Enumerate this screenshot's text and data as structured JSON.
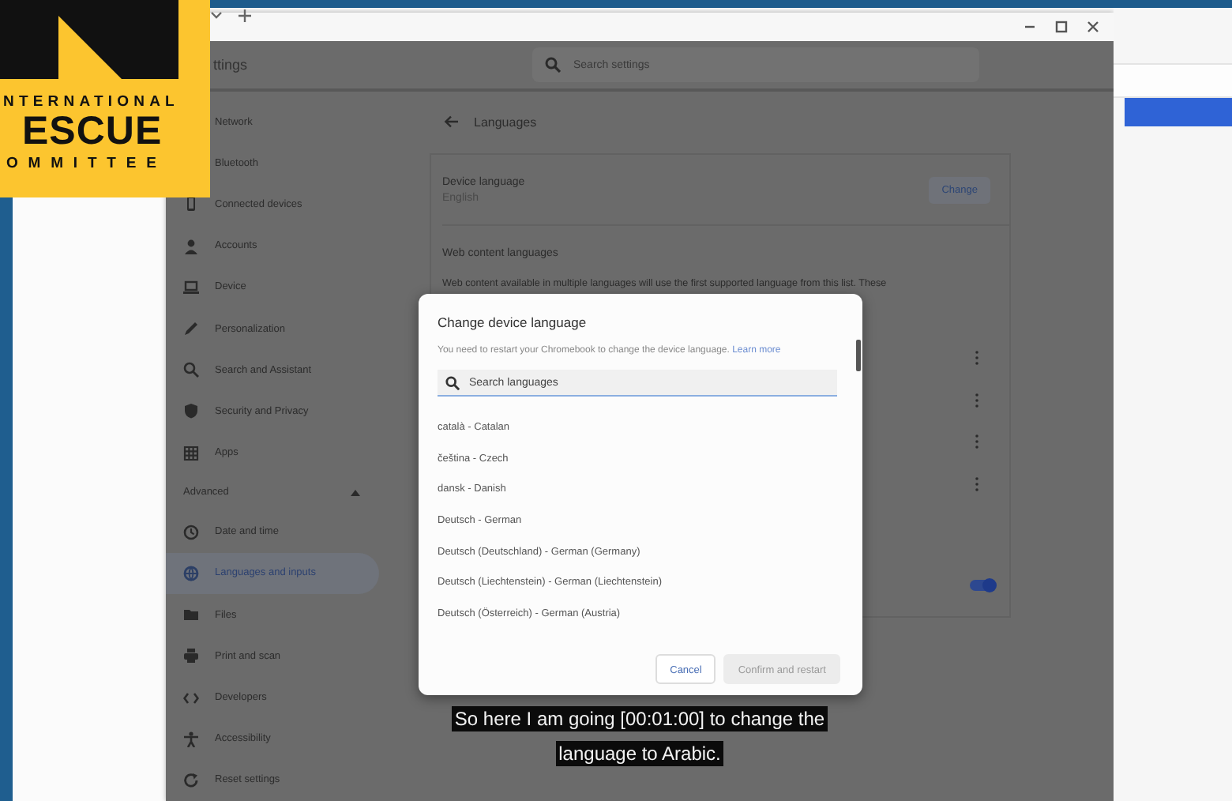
{
  "logo": {
    "lines": [
      "NTERNATIONAL",
      "ESCUE",
      "OMMITTEE"
    ]
  },
  "window": {
    "title": "ttings",
    "search": {
      "placeholder": "Search settings"
    }
  },
  "sidebar": {
    "items": [
      {
        "kind": "item",
        "label": "Network",
        "selected": false
      },
      {
        "kind": "item",
        "label": "Bluetooth",
        "selected": false
      },
      {
        "kind": "item",
        "label": "Connected devices",
        "selected": false
      },
      {
        "kind": "item",
        "label": "Accounts",
        "selected": false
      },
      {
        "kind": "item",
        "label": "Device",
        "selected": false
      },
      {
        "kind": "item",
        "label": "Personalization",
        "selected": false
      },
      {
        "kind": "item",
        "label": "Search and Assistant",
        "selected": false
      },
      {
        "kind": "item",
        "label": "Security and Privacy",
        "selected": false
      },
      {
        "kind": "item",
        "label": "Apps",
        "selected": false
      },
      {
        "kind": "section",
        "label": "Advanced",
        "expanded": true
      },
      {
        "kind": "item",
        "label": "Date and time",
        "selected": false
      },
      {
        "kind": "item",
        "label": "Languages and inputs",
        "selected": true
      },
      {
        "kind": "item",
        "label": "Files",
        "selected": false
      },
      {
        "kind": "item",
        "label": "Print and scan",
        "selected": false
      },
      {
        "kind": "item",
        "label": "Developers",
        "selected": false
      },
      {
        "kind": "item",
        "label": "Accessibility",
        "selected": false
      },
      {
        "kind": "item",
        "label": "Reset settings",
        "selected": false
      }
    ]
  },
  "page": {
    "title": "Languages",
    "device_language": {
      "label": "Device language",
      "value": "English",
      "button": "Change"
    },
    "web_languages": {
      "heading": "Web content languages",
      "description": "Web content available in multiple languages will use the first supported language from this list. These"
    },
    "toggle": {
      "on": true
    }
  },
  "dialog": {
    "title": "Change device language",
    "note": "You need to restart your Chromebook to change the device language.",
    "link": "Learn more",
    "search": {
      "placeholder": "Search languages"
    },
    "languages": [
      "català - Catalan",
      "čeština - Czech",
      "dansk - Danish",
      "Deutsch - German",
      "Deutsch (Deutschland) - German (Germany)",
      "Deutsch (Liechtenstein) - German (Liechtenstein)",
      "Deutsch (Österreich) - German (Austria)"
    ],
    "buttons": [
      {
        "label": "Cancel",
        "kind": "secondary",
        "disabled": false
      },
      {
        "label": "Confirm and restart",
        "kind": "primary",
        "disabled": true
      }
    ]
  },
  "subtitle": {
    "lines": [
      "So here I am going [00:01:00] to change the",
      "language to Arabic."
    ]
  }
}
